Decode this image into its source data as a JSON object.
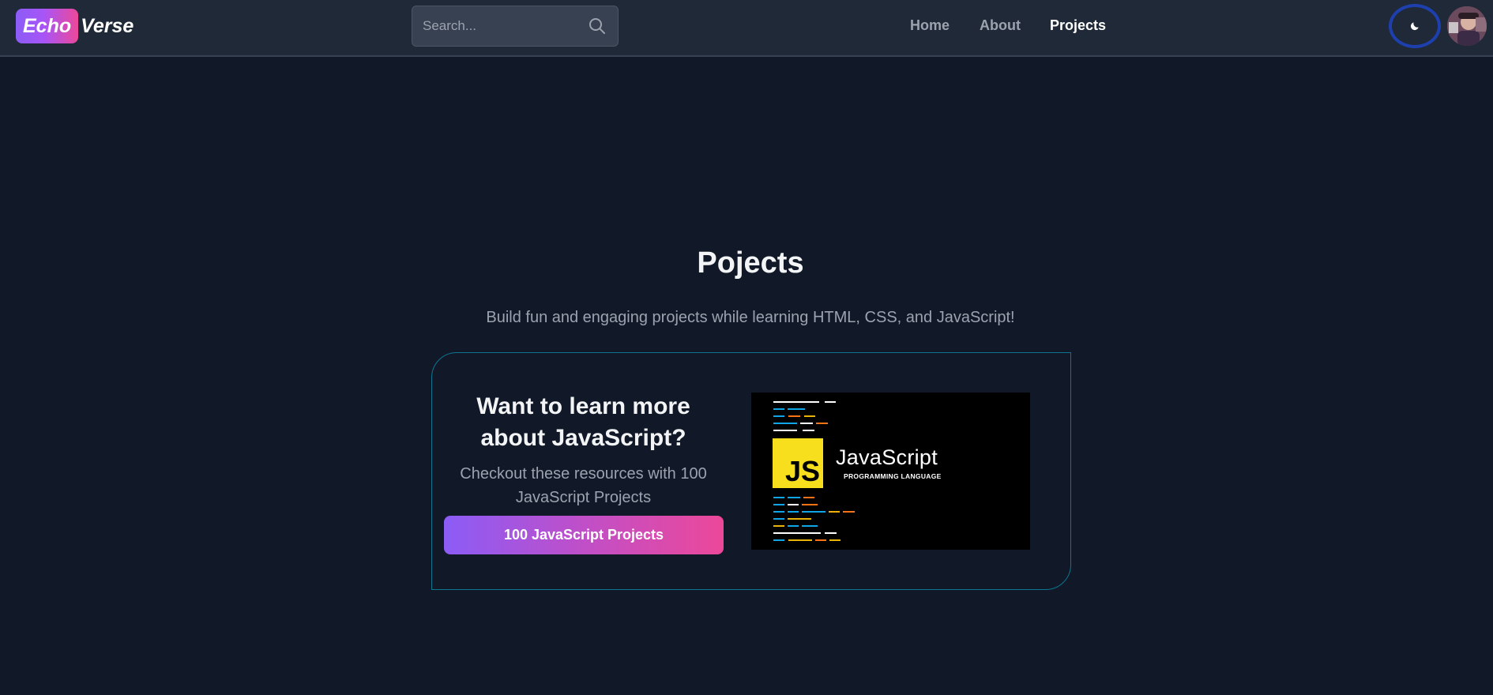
{
  "navbar": {
    "logo": {
      "part1": "Echo",
      "part2": "Verse"
    },
    "search": {
      "placeholder": "Search...",
      "icon": "search-icon"
    },
    "links": [
      {
        "label": "Home",
        "active": false
      },
      {
        "label": "About",
        "active": false
      },
      {
        "label": "Projects",
        "active": true
      }
    ],
    "theme_toggle": {
      "icon": "moon-icon"
    },
    "avatar": {
      "icon": "user-avatar"
    }
  },
  "main": {
    "title": "Pojects",
    "subtitle": "Build fun and engaging projects while learning HTML, CSS, and JavaScript!",
    "card": {
      "heading": "Want to learn more about JavaScript?",
      "text": "Checkout these resources with 100 JavaScript Projects",
      "button_label": "100 JavaScript Projects",
      "image": {
        "badge": "JS",
        "word": "JavaScript",
        "subtitle": "PROGRAMMING LANGUAGE"
      }
    }
  },
  "colors": {
    "background": "#111827",
    "navbar": "#1f2937",
    "accent_purple": "#8b5cf6",
    "accent_pink": "#ec4899",
    "card_border": "#0e7490",
    "js_yellow": "#f7df1e"
  }
}
